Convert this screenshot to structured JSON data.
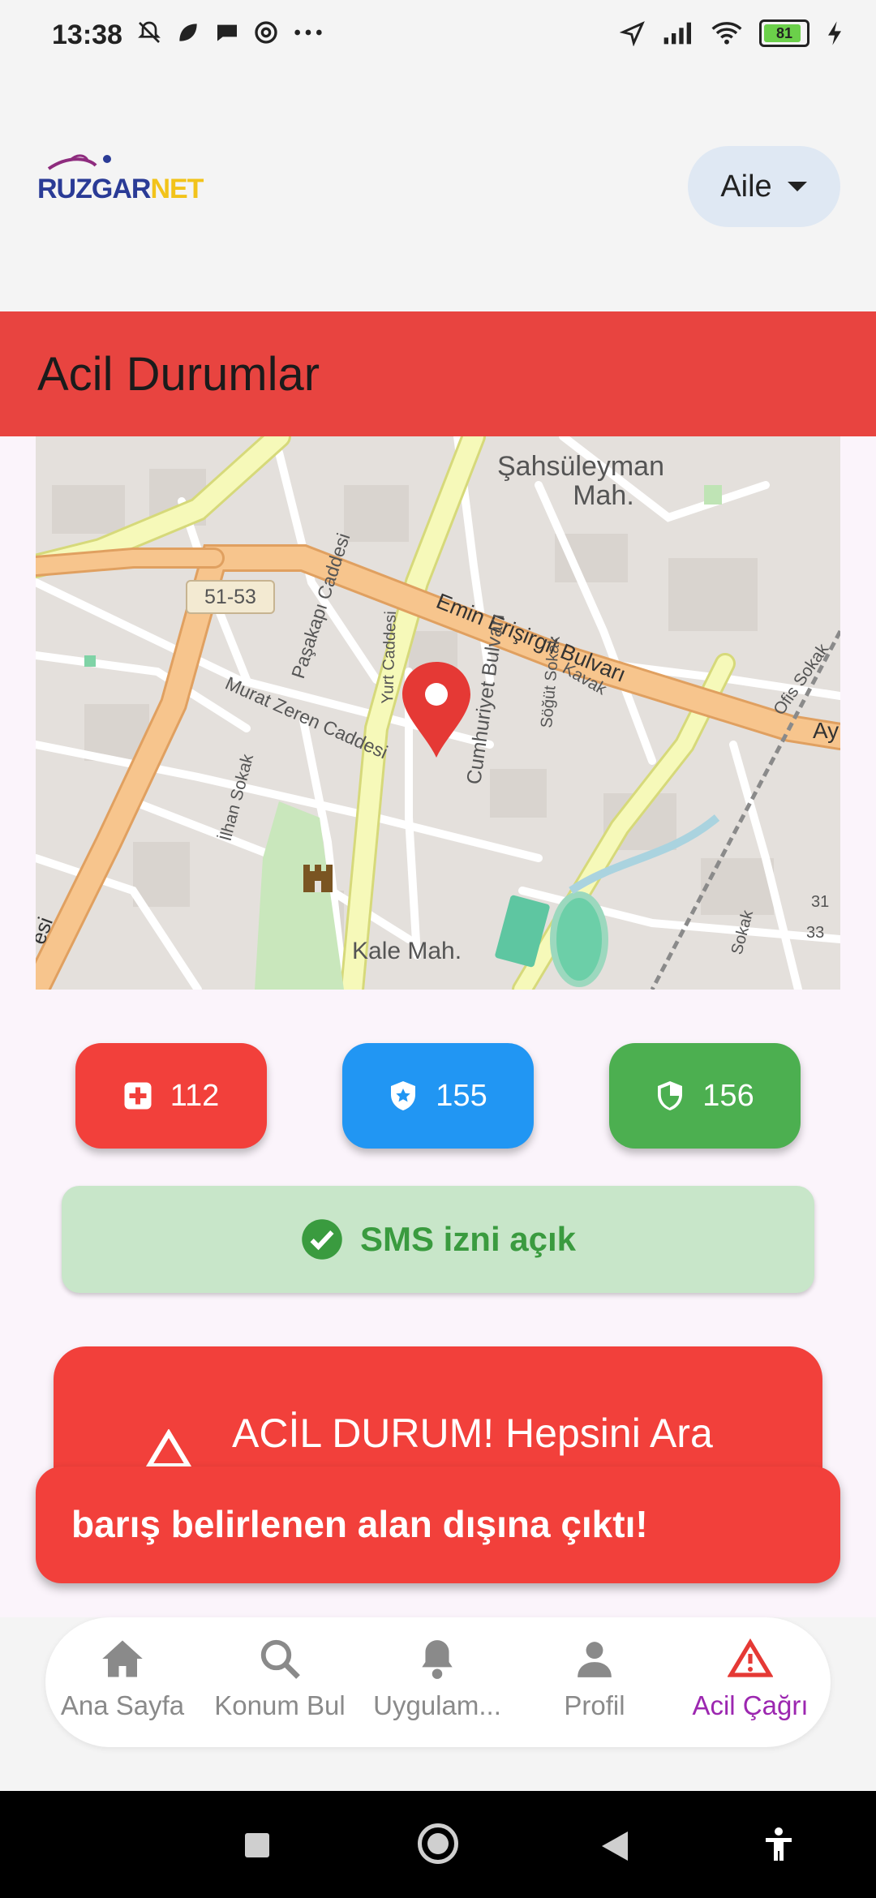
{
  "status_bar": {
    "time": "13:38",
    "battery": "81"
  },
  "header": {
    "logo_text_main": "RUZGAR",
    "logo_text_accent": "NET",
    "family_selector": "Aile"
  },
  "page_title": "Acil Durumlar",
  "map": {
    "labels": {
      "district_1": "Şahsüleyman",
      "district_1b": "Mah.",
      "road_badge": "51-53",
      "street_1": "Emin Erişirgil Bulvarı",
      "street_2": "Paşakapı Caddesi",
      "street_3": "Yurt Caddesi",
      "street_4": "Cumhuriyet Bulvarı",
      "street_5": "Murat Zeren Caddesi",
      "street_6": "Kavak",
      "street_7": "Söğüt Sokak",
      "street_8": "Kale Mah.",
      "street_9": "Ofis Sokak",
      "street_10": "İlhan Sokak",
      "street_11": "Ay",
      "street_12": "31",
      "street_13": "33",
      "street_14": "Sokak",
      "street_15": "esi"
    }
  },
  "emergency_numbers": [
    {
      "label": "112",
      "icon": "medical-cross-icon",
      "color": "#f2403b"
    },
    {
      "label": "155",
      "icon": "police-shield-icon",
      "color": "#2196f3"
    },
    {
      "label": "156",
      "icon": "gendarmerie-shield-icon",
      "color": "#4caf50"
    }
  ],
  "sms_status": "SMS izni açık",
  "call_all_button": "ACİL DURUM! Hepsini Ara",
  "toast_message": "barış belirlenen alan dışına çıktı!",
  "bottom_nav": [
    {
      "label": "Ana Sayfa",
      "icon": "home-icon"
    },
    {
      "label": "Konum Bul",
      "icon": "search-icon"
    },
    {
      "label": "Uygulam...",
      "icon": "bell-icon"
    },
    {
      "label": "Profil",
      "icon": "person-icon"
    },
    {
      "label": "Acil Çağrı",
      "icon": "warning-icon",
      "active": true
    }
  ],
  "colors": {
    "header_red": "#e84440",
    "button_red": "#f2403b",
    "button_blue": "#2196f3",
    "button_green": "#4caf50",
    "sms_bg": "#c8e6c9",
    "nav_active": "#9c27b0"
  }
}
